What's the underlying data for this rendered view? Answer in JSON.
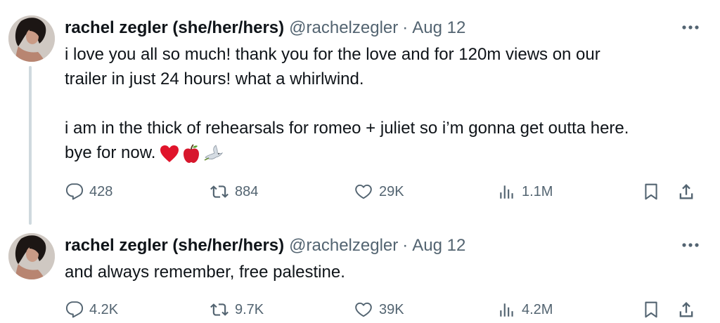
{
  "tweets": [
    {
      "author": {
        "name": "rachel zegler (she/her/hers)",
        "handle": "@rachelzegler"
      },
      "separator": "·",
      "date": "Aug 12",
      "text_lines": [
        "i love you all so much! thank you for the love and for 120m views on our",
        "trailer in just 24 hours! what a whirlwind.",
        "",
        "i am in the thick of rehearsals for romeo + juliet so i’m gonna get outta here.",
        "bye for now."
      ],
      "emojis": [
        "red-heart",
        "red-apple",
        "dove"
      ],
      "stats": {
        "replies": "428",
        "reposts": "884",
        "likes": "29K",
        "views": "1.1M"
      }
    },
    {
      "author": {
        "name": "rachel zegler (she/her/hers)",
        "handle": "@rachelzegler"
      },
      "separator": "·",
      "date": "Aug 12",
      "text_lines": [
        "and always remember, free palestine."
      ],
      "stats": {
        "replies": "4.2K",
        "reposts": "9.7K",
        "likes": "39K",
        "views": "4.2M"
      }
    }
  ],
  "icons": {
    "reply": "reply-icon",
    "repost": "repost-icon",
    "like": "like-icon",
    "views": "views-icon",
    "bookmark": "bookmark-icon",
    "share": "share-icon",
    "more": "more-icon"
  },
  "colors": {
    "text": "#0f1419",
    "secondary": "#536471",
    "thread_line": "#cfd9de"
  }
}
